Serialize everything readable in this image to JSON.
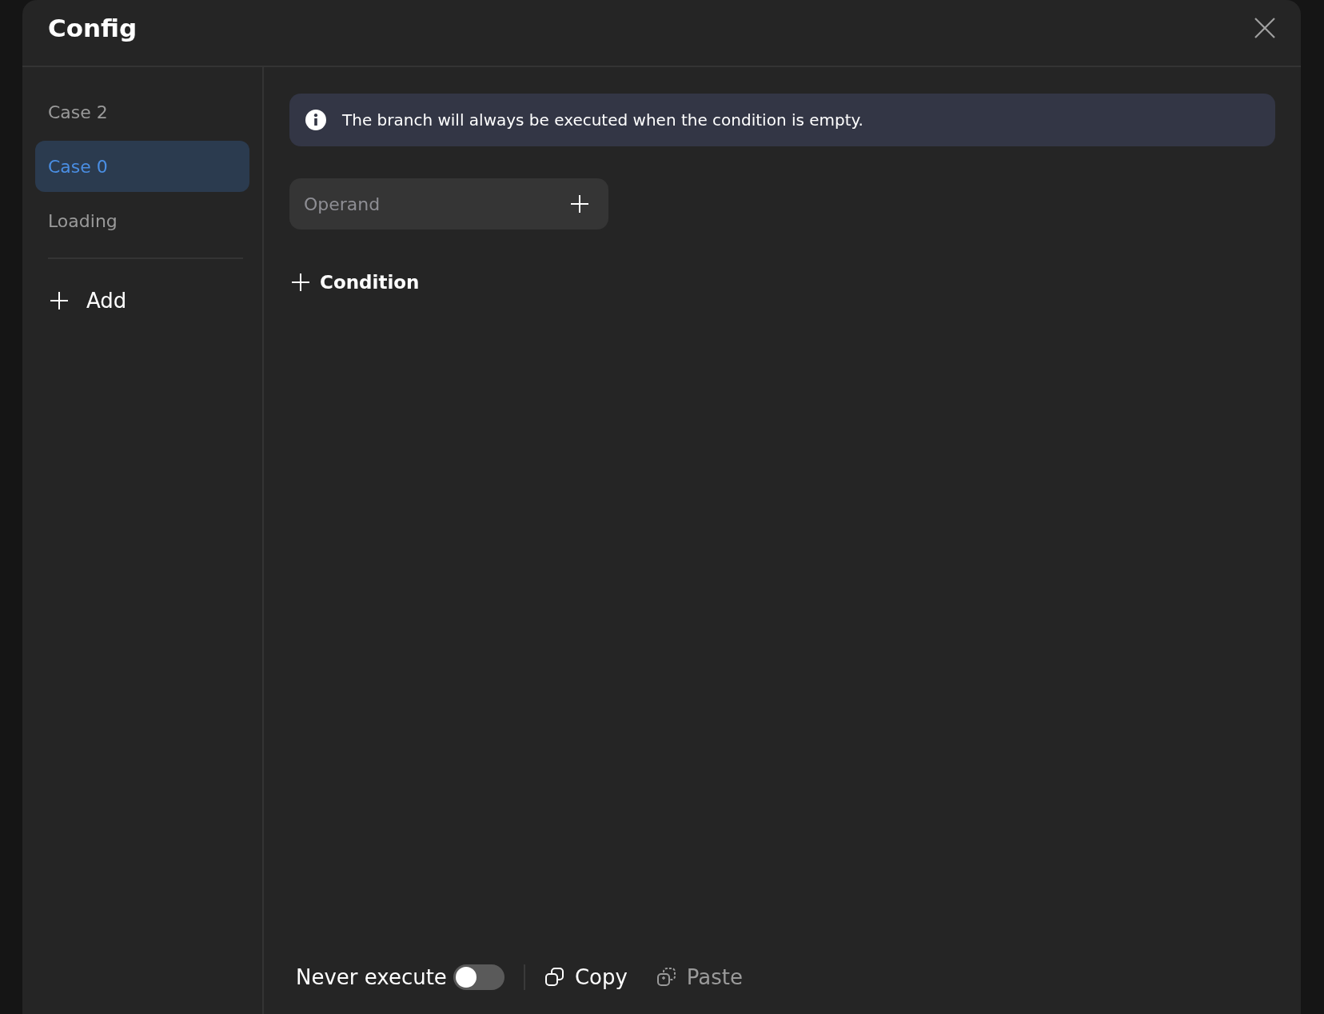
{
  "dialog": {
    "title": "Config"
  },
  "sidebar": {
    "items": [
      {
        "label": "Case 2",
        "selected": false
      },
      {
        "label": "Case 0",
        "selected": true
      },
      {
        "label": "Loading",
        "selected": false
      }
    ],
    "add_button": "Add"
  },
  "info_banner": "The branch will always be executed when the condition is empty.",
  "operand_field": {
    "placeholder": "Operand"
  },
  "add_condition_button": "Condition",
  "footer": {
    "never_execute": {
      "label": "Never execute",
      "on": false
    },
    "actions": [
      {
        "kind": "copy",
        "label": "Copy",
        "disabled": false
      },
      {
        "kind": "paste",
        "label": "Paste",
        "disabled": true
      }
    ]
  }
}
